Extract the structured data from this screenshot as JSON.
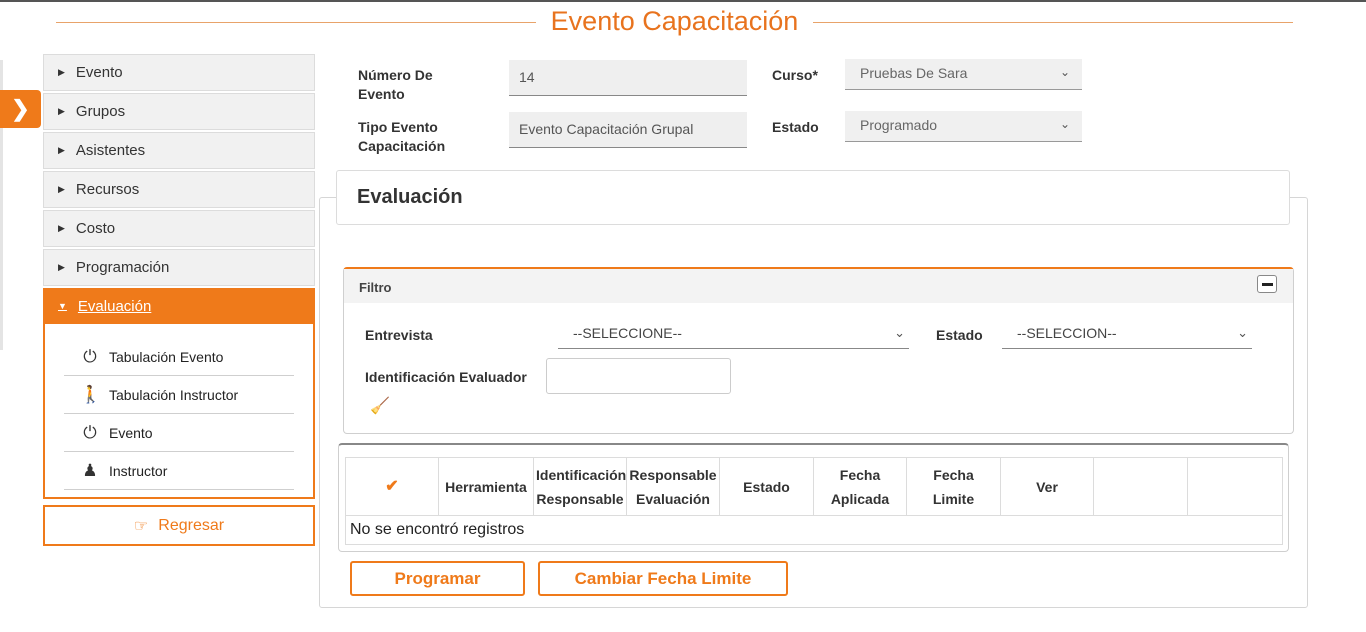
{
  "page": {
    "title": "Evento Capacitación"
  },
  "colors": {
    "accent": "#ef7a1a"
  },
  "sidebar": {
    "toggle_icon": "chevron-right-icon",
    "items": [
      {
        "label": "Evento"
      },
      {
        "label": "Grupos"
      },
      {
        "label": "Asistentes"
      },
      {
        "label": "Recursos"
      },
      {
        "label": "Costo"
      },
      {
        "label": "Programación"
      },
      {
        "label": "Evaluación",
        "active": true
      }
    ],
    "subitems": [
      {
        "label": "Tabulación Evento",
        "icon": "power-icon"
      },
      {
        "label": "Tabulación Instructor",
        "icon": "walking-person-icon"
      },
      {
        "label": "Evento",
        "icon": "power-icon"
      },
      {
        "label": "Instructor",
        "icon": "user-icon"
      }
    ],
    "back_label": "Regresar"
  },
  "form": {
    "numero_label_1": "Número De",
    "numero_label_2": "Evento",
    "numero_value": "14",
    "curso_label": "Curso*",
    "curso_value": "Pruebas De Sara",
    "tipo_label_1": "Tipo Evento",
    "tipo_label_2": "Capacitación",
    "tipo_value": "Evento Capacitación Grupal",
    "estado_label": "Estado",
    "estado_value": "Programado"
  },
  "evaluacion": {
    "title": "Evaluación",
    "filter": {
      "title": "Filtro",
      "entrevista_label": "Entrevista",
      "entrevista_value": "--SELECCIONE--",
      "estado_label": "Estado",
      "estado_value": "--SELECCION--",
      "identificacion_label": "Identificación Evaluador",
      "identificacion_value": ""
    },
    "table": {
      "check_icon": "checkmark-icon",
      "headers": [
        {
          "l1": "Herramienta",
          "l2": ""
        },
        {
          "l1": "Identificación",
          "l2": "Responsable"
        },
        {
          "l1": "Responsable",
          "l2": "Evaluación"
        },
        {
          "l1": "Estado",
          "l2": ""
        },
        {
          "l1": "Fecha",
          "l2": "Aplicada"
        },
        {
          "l1": "Fecha",
          "l2": "Limite"
        },
        {
          "l1": "Ver",
          "l2": ""
        }
      ],
      "empty_message": "No se encontró registros"
    },
    "buttons": {
      "programar": "Programar",
      "cambiar": "Cambiar Fecha Limite"
    }
  }
}
